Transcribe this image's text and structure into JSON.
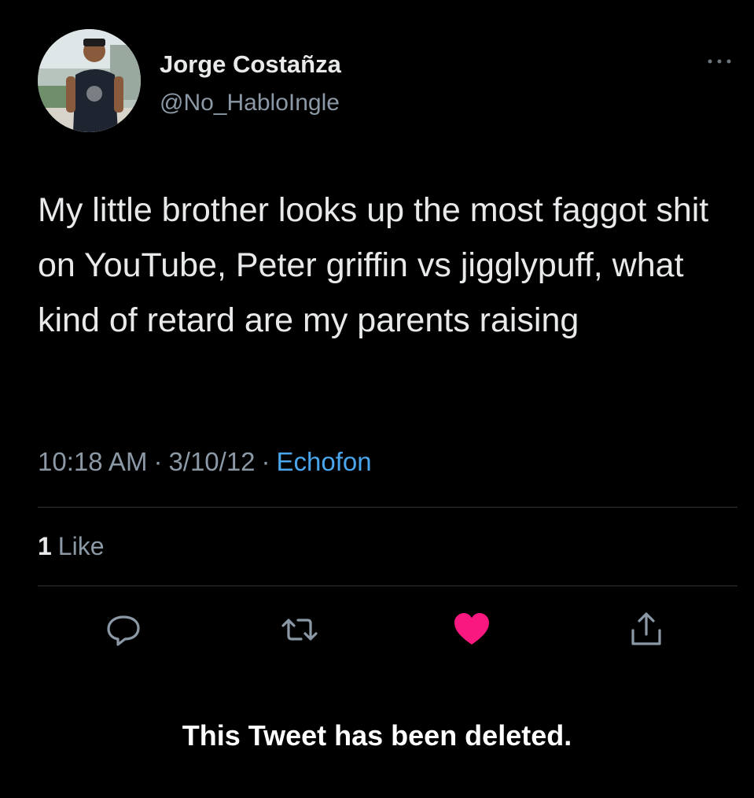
{
  "author": {
    "display_name": "Jorge Costañza",
    "handle": "@No_HabloIngle"
  },
  "tweet": {
    "text": "My little brother looks up the most faggot shit on YouTube, Peter griffin vs jigglypuff, what kind of retard are my parents raising",
    "time": "10:18 AM",
    "separator": "·",
    "date": "3/10/12",
    "source": "Echofon"
  },
  "stats": {
    "like_count": "1",
    "like_label": "Like"
  },
  "actions": {
    "reply_icon": "reply-icon",
    "retweet_icon": "retweet-icon",
    "like_icon": "heart-icon",
    "share_icon": "share-icon",
    "liked": true
  },
  "notice": "This Tweet has been deleted.",
  "colors": {
    "background": "#000000",
    "text_primary": "#e7e9ea",
    "text_secondary": "#8b98a5",
    "link": "#4aa6ec",
    "like": "#f91880",
    "divider": "#2f3336"
  }
}
